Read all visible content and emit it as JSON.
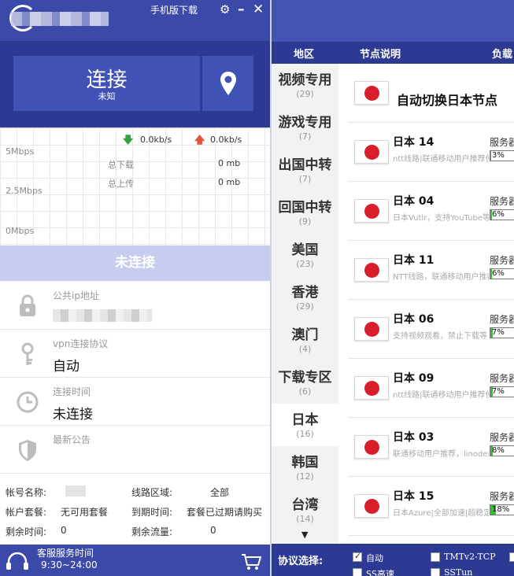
{
  "left": {
    "header": {
      "mobile_download": "手机版下载"
    },
    "connect": {
      "label": "连接",
      "sublabel": "未知"
    },
    "stats": {
      "down_speed": "0.0kb/s",
      "up_speed": "0.0kb/s",
      "total_download_label": "总下载",
      "total_download": "0 mb",
      "total_upload_label": "总上传",
      "total_upload": "0 mb",
      "y_labels": [
        "5Mbps",
        "2.5Mbps",
        "0Mbps"
      ]
    },
    "status": "未连接",
    "rows": [
      {
        "label": "公共ip地址",
        "value": ""
      },
      {
        "label": "vpn连接协议",
        "value": "自动"
      },
      {
        "label": "连接时间",
        "value": "未连接"
      },
      {
        "label": "最新公告",
        "value": ""
      }
    ],
    "account": {
      "name_label": "帐号名称:",
      "line_label": "线路区域:",
      "line_value": "全部",
      "plan_label": "帐户套餐:",
      "plan_value": "无可用套餐",
      "expire_label": "到期时间:",
      "expire_value": "套餐已过期请购买",
      "time_label": "剩余时间:",
      "time_value": "0",
      "traffic_label": "剩余流量:",
      "traffic_value": "0"
    },
    "footer": {
      "service_label": "客服服务时间",
      "service_hours": "9:30~24:00"
    }
  },
  "right": {
    "columns": [
      "地区",
      "节点说明",
      "负载"
    ],
    "regions": [
      {
        "name": "视频专用",
        "count": "(29)"
      },
      {
        "name": "游戏专用",
        "count": "(7)"
      },
      {
        "name": "出国中转",
        "count": "(7)"
      },
      {
        "name": "回国中转",
        "count": "(9)"
      },
      {
        "name": "美国",
        "count": "(23)"
      },
      {
        "name": "香港",
        "count": "(29)"
      },
      {
        "name": "澳门",
        "count": "(4)"
      },
      {
        "name": "下载专区",
        "count": "(6)"
      },
      {
        "name": "日本",
        "count": "(16)"
      },
      {
        "name": "韩国",
        "count": "(12)"
      },
      {
        "name": "台湾",
        "count": "(14)"
      }
    ],
    "selected_region": "日本",
    "scroll_arrow": "▼",
    "auto_node": "自动切换日本节点",
    "nodes": [
      {
        "name": "日本 14",
        "desc": "ntt线路|联通移动用户推荐使用",
        "label": "服务器",
        "load": "3%",
        "fill": 0.03
      },
      {
        "name": "日本 04",
        "desc": "日本Vutlr，支持YouTube等视频",
        "label": "服务器",
        "load": "6%",
        "fill": 0.06
      },
      {
        "name": "日本 11",
        "desc": "NTT线路，联通移动用户推荐使用",
        "label": "服务器",
        "load": "6%",
        "fill": 0.06
      },
      {
        "name": "日本 06",
        "desc": "支持视频观看，禁止下载等",
        "label": "服务器",
        "load": "7%",
        "fill": 0.07
      },
      {
        "name": "日本 09",
        "desc": "ntt线路|联通移动用户推荐使用",
        "label": "服务器",
        "load": "7%",
        "fill": 0.07
      },
      {
        "name": "日本 03",
        "desc": "联通移动用户推荐，linode线路",
        "label": "服务器",
        "load": "8%",
        "fill": 0.08
      },
      {
        "name": "日本 15",
        "desc": "日本Azure|全部加速|超稳定",
        "label": "服务器",
        "load": "18%",
        "fill": 0.18
      }
    ],
    "protocol": {
      "label": "协议选择:",
      "options": [
        {
          "name": "自动",
          "checked": true
        },
        {
          "name": "TMTv2-TCP",
          "checked": false
        },
        {
          "name": "SS高速",
          "checked": false
        },
        {
          "name": "SSTun",
          "checked": false
        }
      ]
    }
  }
}
